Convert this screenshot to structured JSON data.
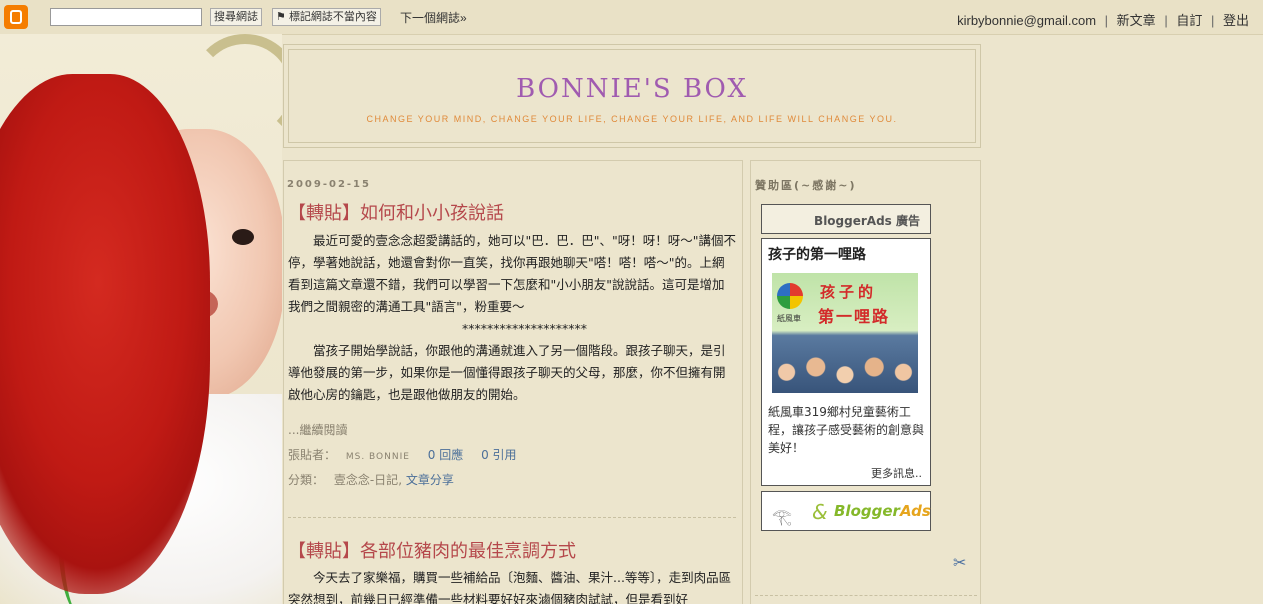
{
  "navbar": {
    "search_button": "搜尋網誌",
    "flag_button": "標記網誌不當內容",
    "next_blog": "下一個網誌»",
    "email": "kirbybonnie@gmail.com",
    "new_post": "新文章",
    "customize": "自訂",
    "sign_out": "登出",
    "separator": "|"
  },
  "header": {
    "title": "BONNIE'S BOX",
    "description": "CHANGE YOUR MIND, CHANGE YOUR LIFE, CHANGE YOUR LIFE, AND LIFE WILL CHANGE YOU."
  },
  "posts": [
    {
      "date": "2009-02-15",
      "title": "【轉貼】如何和小小孩說話",
      "para1": "最近可愛的壹念念超愛講話的，她可以\"巴．巴．巴\"、\"呀！呀！呀～\"講個不停，學著她說話，她還會對你一直笑，找你再跟她聊天\"嗒！嗒！嗒～\"的。上網看到這篇文章還不錯，我們可以學習一下怎麼和\"小小朋友\"說說話。這可是增加我們之間親密的溝通工具\"語言\"，粉重要～",
      "stars": "********************",
      "para2": "當孩子開始學說話，你跟他的溝通就進入了另一個階段。跟孩子聊天，是引導他發展的第一步，如果你是一個懂得跟孩子聊天的父母，那麼，你不但擁有開啟他心房的鑰匙，也是跟他做朋友的開始。",
      "read_more": "...繼續閱讀",
      "posted_by_label": "張貼者：",
      "author": "MS. BONNIE",
      "comments": "0 回應",
      "trackbacks": "0 引用",
      "labels_label": "分類：",
      "label1": "壹念念-日記",
      "label_sep": ",",
      "label2": "文章分享"
    },
    {
      "title": "【轉貼】各部位豬肉的最佳烹調方式",
      "para1": "今天去了家樂福，購買一些補給品〔泡麵、醬油、果汁...等等〕，走到肉品區突然想到，前幾日已經準備一些材料要好好來滷個豬肉試試，但是看到好"
    }
  ],
  "sidebar": {
    "title": "贊助區(~感謝~)",
    "ads_header": "BloggerAds 廣告",
    "ad_title": "孩子的第一哩路",
    "ad_image_heading1": "孩子的",
    "ad_image_heading2": "第一哩路",
    "ad_image_sub": "紙風車",
    "ad_text": "紙風車319鄉村兒童藝術工程，讓孩子感受藝術的創意與美好！",
    "ad_more": "更多訊息..",
    "footer_amp": "&",
    "footer_brand_1": "Blogger",
    "footer_brand_2": "Ads"
  }
}
